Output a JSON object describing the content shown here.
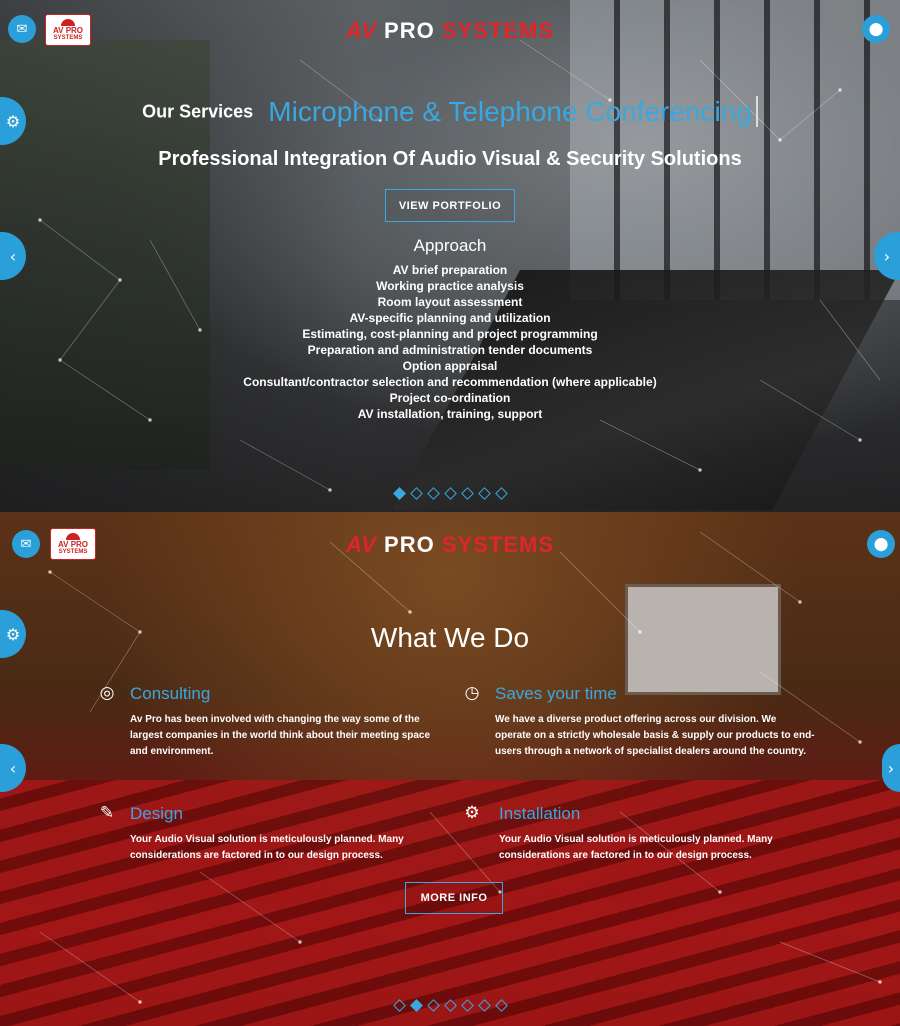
{
  "header": {
    "brand": {
      "part1": "AV",
      "part2": "PRO",
      "part3": "SYSTEMS"
    },
    "logo": {
      "line1": "AV PRO",
      "line2": "SYSTEMS"
    },
    "mail_icon": "mail-icon",
    "location_icon": "location-pin-icon"
  },
  "slide1": {
    "services_label": "Our Services",
    "typed_service": "Microphone & Telephone Conferencing",
    "headline": "Professional Integration Of Audio Visual & Security Solutions",
    "portfolio_button": "VIEW PORTFOLIO",
    "approach_title": "Approach",
    "approach_items": [
      "AV brief preparation",
      "Working practice analysis",
      "Room layout assessment",
      "AV-specific planning and utilization",
      "Estimating, cost-planning and project programming",
      "Preparation and administration tender documents",
      "Option appraisal",
      "Consultant/contractor selection and recommendation (where applicable)",
      "Project co-ordination",
      "AV installation, training, support"
    ],
    "dots": {
      "count": 7,
      "active": 0
    }
  },
  "slide2": {
    "title": "What We Do",
    "features": [
      {
        "icon": "lifebuoy-icon",
        "title": "Consulting",
        "text": "Av Pro has been involved with changing the way some of the largest companies in the world think about their meeting space and environment."
      },
      {
        "icon": "clock-icon",
        "title": "Saves your time",
        "text": "We have a diverse product offering across our division. We operate on a strictly wholesale basis & supply our products to end-users through a network of specialist dealers around the country."
      },
      {
        "icon": "paintbrush-icon",
        "title": "Design",
        "text": "Your Audio Visual solution is meticulously planned. Many considerations are factored in to our design process."
      },
      {
        "icon": "cogs-icon",
        "title": "Installation",
        "text": "Your Audio Visual solution is meticulously planned. Many considerations are factored in to our design process."
      }
    ],
    "more_button": "MORE INFO",
    "dots": {
      "count": 7,
      "active": 1
    }
  },
  "colors": {
    "accent": "#2b9fd9",
    "brand_red": "#e0242a",
    "link_blue": "#3aa8e0"
  }
}
